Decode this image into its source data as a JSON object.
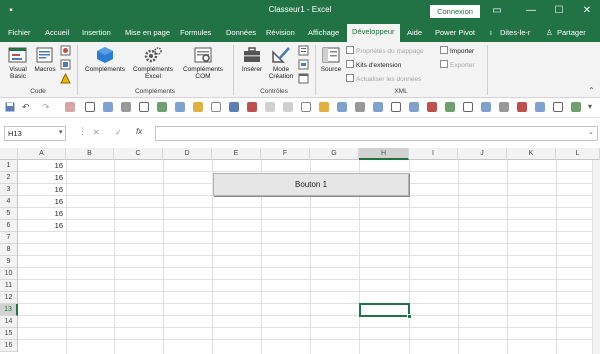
{
  "window": {
    "title": "Classeur1 - Excel",
    "signin": "Connexion"
  },
  "tabs": [
    {
      "label": "Fichier"
    },
    {
      "label": "Accueil"
    },
    {
      "label": "Insertion"
    },
    {
      "label": "Mise en page"
    },
    {
      "label": "Formules"
    },
    {
      "label": "Données"
    },
    {
      "label": "Révision"
    },
    {
      "label": "Affichage"
    },
    {
      "label": "Développeur"
    },
    {
      "label": "Aide"
    },
    {
      "label": "Power Pivot"
    },
    {
      "label": "Dites-le-r"
    },
    {
      "label": "Partager"
    }
  ],
  "ribbon": {
    "code": {
      "label": "Code",
      "visual_basic": "Visual Basic",
      "macros": "Macros"
    },
    "complements": {
      "label": "Compléments",
      "complements": "Compléments",
      "complements_excel": "Compléments Excel",
      "complements_com": "Compléments COM"
    },
    "controles": {
      "label": "Contrôles",
      "inserer": "Insérer",
      "mode_creation": "Mode Création"
    },
    "xml": {
      "label": "XML",
      "source": "Source",
      "proprietes": "Propriétés du mappage",
      "kits": "Kits d'extension",
      "actualiser": "Actualiser les données",
      "importer": "Importer",
      "exporter": "Exporter"
    }
  },
  "formula_bar": {
    "name_box": "H13",
    "cancel": "✕",
    "enter": "✓",
    "fx": "fx",
    "value": ""
  },
  "sheet": {
    "columns": [
      "A",
      "B",
      "C",
      "D",
      "E",
      "F",
      "G",
      "H",
      "I",
      "J",
      "K",
      "L"
    ],
    "rows": [
      "1",
      "2",
      "3",
      "4",
      "5",
      "6",
      "7",
      "8",
      "9",
      "10",
      "11",
      "12",
      "13",
      "14",
      "15",
      "16"
    ],
    "col_a_values": [
      "16",
      "16",
      "16",
      "16",
      "16",
      "16"
    ],
    "button_label": "Bouton 1",
    "selected_cell": "H13"
  },
  "colors": {
    "accent": "#217346",
    "ribbon_bg": "#f3f3f3"
  }
}
